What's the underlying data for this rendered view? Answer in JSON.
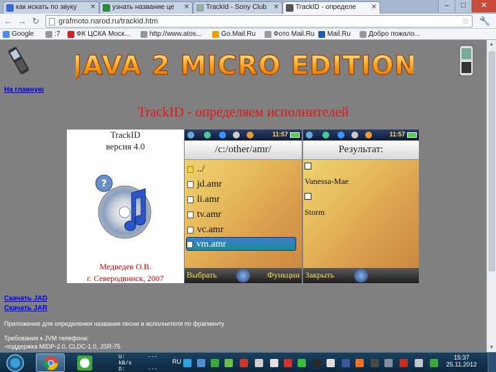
{
  "tabs": [
    {
      "label": "как искать по звуку",
      "color": "#3a6ad8"
    },
    {
      "label": "узнать название це",
      "color": "#2c8c3c"
    },
    {
      "label": "TrackId - Sony Club",
      "color": "#9aa"
    },
    {
      "label": "TrackID - определе",
      "color": "#333"
    }
  ],
  "window_buttons": {
    "minimize": "–",
    "maximize": "□",
    "close": "✕"
  },
  "address": {
    "url": "grafmoto.narod.ru/trackid.htm"
  },
  "bookmarks": [
    {
      "label": "Google",
      "color": "#4a8bf5"
    },
    {
      "label": ":7",
      "color": "#999"
    },
    {
      "label": "ФК ЦСКА Моск...",
      "color": "#c22"
    },
    {
      "label": "http://www.atos...",
      "color": "#999"
    },
    {
      "label": "Go.Mail.Ru",
      "color": "#f0a000"
    },
    {
      "label": "Фото Mail.Ru",
      "color": "#999"
    },
    {
      "label": "Mail.Ru",
      "color": "#1a5fb4"
    },
    {
      "label": "Добро пожало...",
      "color": "#999"
    }
  ],
  "page": {
    "banner_text": "JAVA 2 MICRO EDITION",
    "home_link": "На главную",
    "title": "TrackID - определяем исполнителей",
    "app_card": {
      "name": "TrackID",
      "version": "версия 4.0",
      "author": "Медведев О.В.",
      "city": "г. Северодвинск, 2007"
    },
    "file_screen": {
      "time": "11:57",
      "header": "/c:/other/amr/",
      "files": [
        "../",
        "jd.amr",
        "li.amr",
        "tv.amr",
        "vc.amr",
        "vm.amr"
      ],
      "selected_index": 5,
      "left_softkey": "Выбрать",
      "right_softkey": "Функции"
    },
    "result_screen": {
      "time": "11:57",
      "header": "Результат:",
      "results": [
        {
          "label": "Vanessa-Mae"
        },
        {
          "label": "Storm"
        }
      ],
      "left_softkey": "Закрыть"
    },
    "downloads": {
      "jad": "Скачать JAD",
      "jar": "Скачать JAR"
    },
    "description": "Приложение для определения названия песни и исполнителя по фрагменту",
    "requirements": "Требования к JVM телефона:",
    "support": "-поддержка MIDP-2.0, CLDC-1.0, JSR-75"
  },
  "taskbar": {
    "net_up_label": "U:",
    "net_down_label": "D:",
    "net_up": "--- kB/s",
    "net_down": "--- kB/s",
    "lang": "RU",
    "time": "15:37",
    "date": "25.11.2012"
  }
}
